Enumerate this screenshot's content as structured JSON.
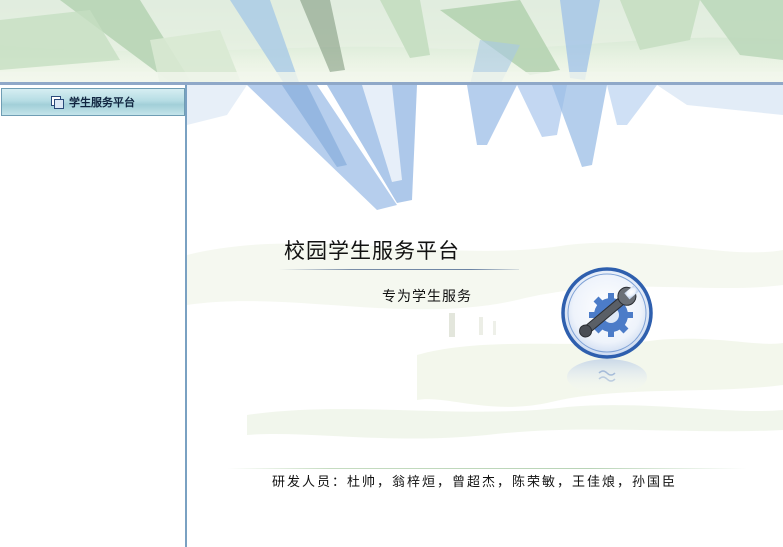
{
  "sidebar": {
    "header_label": "学生服务平台"
  },
  "main": {
    "title": "校园学生服务平台",
    "subtitle": "专为学生服务",
    "developers": "研发人员：杜帅，翁梓烜，曾超杰，陈荣敏，王佳烺，孙国臣"
  },
  "colors": {
    "sidebar_border": "#7aa1c2",
    "banner_green": "#cfe3d3",
    "leaf_blue": "#9ec0e8",
    "logo_ring": "#2e5fae"
  },
  "icons": {
    "sidebar_header_icon": "windows-stack-icon",
    "logo_icon": "wrench-gear-icon"
  }
}
